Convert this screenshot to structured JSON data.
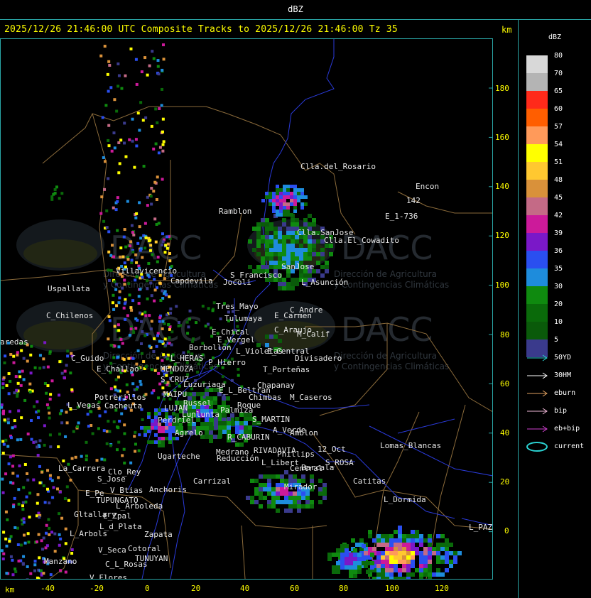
{
  "header": {
    "title": "dBZ"
  },
  "subtitle": "2025/12/26 21:46:00 UTC Composite Tracks to 2025/12/26 21:46:00 Tz 35",
  "axes": {
    "unit_label": "km",
    "y_ticks": [
      "180",
      "160",
      "140",
      "120",
      "100",
      "80",
      "60",
      "40",
      "20",
      "0"
    ],
    "x_ticks": [
      "-40",
      "-20",
      "0",
      "20",
      "40",
      "60",
      "80",
      "100",
      "120"
    ]
  },
  "legend": {
    "title": "dBZ",
    "bins": [
      {
        "label": "80",
        "color": "#d8d8d8"
      },
      {
        "label": "70",
        "color": "#b4b4b4"
      },
      {
        "label": "65",
        "color": "#ff2a1a"
      },
      {
        "label": "60",
        "color": "#ff5e00"
      },
      {
        "label": "57",
        "color": "#ff9a5a"
      },
      {
        "label": "54",
        "color": "#ffff00"
      },
      {
        "label": "51",
        "color": "#ffc830"
      },
      {
        "label": "48",
        "color": "#d9913a"
      },
      {
        "label": "45",
        "color": "#c46a86"
      },
      {
        "label": "42",
        "color": "#cc1a9a"
      },
      {
        "label": "39",
        "color": "#7a18c8"
      },
      {
        "label": "36",
        "color": "#2a4ff0"
      },
      {
        "label": "35",
        "color": "#1e8cdc"
      },
      {
        "label": "30",
        "color": "#0f8a0f"
      },
      {
        "label": "20",
        "color": "#0a6a0a"
      },
      {
        "label": "10",
        "color": "#0a5a0a"
      },
      {
        "label": "5",
        "color": "#3a3a8c"
      }
    ],
    "tracks": [
      {
        "label": "50YD",
        "color": "#2ad0d0"
      },
      {
        "label": "30HM",
        "color": "#ffffff"
      },
      {
        "label": "eburn",
        "color": "#e0a060"
      },
      {
        "label": "bip",
        "color": "#f0b8d8"
      },
      {
        "label": "eb+bip",
        "color": "#d040d0"
      },
      {
        "label": "current",
        "color": "#2ad0d0"
      }
    ]
  },
  "places": [
    {
      "name": "Clla.del_Rosario"
    },
    {
      "name": "Encon"
    },
    {
      "name": "142"
    },
    {
      "name": "E_1-736"
    },
    {
      "name": "Ramblon"
    },
    {
      "name": "Clla.SanJose"
    },
    {
      "name": "Clla.El_Cowadito"
    },
    {
      "name": "Villavicencio"
    },
    {
      "name": "Capdevila"
    },
    {
      "name": "S_Francisco"
    },
    {
      "name": "Jocoli"
    },
    {
      "name": "SanJose"
    },
    {
      "name": "L_Asunción"
    },
    {
      "name": "Uspallata"
    },
    {
      "name": "Tres_Mayo"
    },
    {
      "name": "C_Andre"
    },
    {
      "name": "C_Chilenos"
    },
    {
      "name": "Tulumaya"
    },
    {
      "name": "E_Carmen"
    },
    {
      "name": "E_Chical"
    },
    {
      "name": "C_Araujo"
    },
    {
      "name": "M_Calif"
    },
    {
      "name": "E_Vergel"
    },
    {
      "name": "Borbollon"
    },
    {
      "name": "L_Violetas"
    },
    {
      "name": "E_Central"
    },
    {
      "name": "Divisadero"
    },
    {
      "name": "aredas"
    },
    {
      "name": "C_Guido"
    },
    {
      "name": "L_HERAS"
    },
    {
      "name": "P_Hierro"
    },
    {
      "name": "E_Challao"
    },
    {
      "name": "MENDOZA"
    },
    {
      "name": "T_Porteñas"
    },
    {
      "name": "S_CRUZ"
    },
    {
      "name": "Luzuriaga"
    },
    {
      "name": "Chapanay"
    },
    {
      "name": "E_L_Beltran"
    },
    {
      "name": "Potrerillos"
    },
    {
      "name": "MAIPU"
    },
    {
      "name": "Chimbas"
    },
    {
      "name": "M_Caseros"
    },
    {
      "name": "L_Vegas"
    },
    {
      "name": "Cacheuta"
    },
    {
      "name": "Russel"
    },
    {
      "name": "Roque"
    },
    {
      "name": "LUJAN"
    },
    {
      "name": "Lunlunta"
    },
    {
      "name": "Palmiza"
    },
    {
      "name": "S_MARTIN"
    },
    {
      "name": "Perdriel"
    },
    {
      "name": "A_Verde"
    },
    {
      "name": "Amblon"
    },
    {
      "name": "Agrelo"
    },
    {
      "name": "R_CABURIN"
    },
    {
      "name": "Lomas_Blancas"
    },
    {
      "name": "Medrano"
    },
    {
      "name": "RIVADAVIA"
    },
    {
      "name": "12_Oct"
    },
    {
      "name": "Ugarteche"
    },
    {
      "name": "Reducción"
    },
    {
      "name": "Phillips"
    },
    {
      "name": "L_Libert"
    },
    {
      "name": "S_ROSA"
    },
    {
      "name": "La_Carrera"
    },
    {
      "name": "Clo_Rey"
    },
    {
      "name": "Carrizal"
    },
    {
      "name": "Barcala"
    },
    {
      "name": "Catitas"
    },
    {
      "name": "S_Jose"
    },
    {
      "name": "Anchoris"
    },
    {
      "name": "E_Pe"
    },
    {
      "name": "V_Btias"
    },
    {
      "name": "Mirador"
    },
    {
      "name": "Central"
    },
    {
      "name": "TUPUNGATO"
    },
    {
      "name": "L_Arboleda"
    },
    {
      "name": "L_Dormida"
    },
    {
      "name": "Gltallary"
    },
    {
      "name": "E_Zpal"
    },
    {
      "name": "L_d_Plata"
    },
    {
      "name": "L_PAZ"
    },
    {
      "name": "L_Arbols"
    },
    {
      "name": "Zapata"
    },
    {
      "name": "V_Seca"
    },
    {
      "name": "Cotoral"
    },
    {
      "name": "Manzano"
    },
    {
      "name": "TUNUYAN"
    },
    {
      "name": "C_L_Rosas"
    },
    {
      "name": "V_Flores"
    }
  ],
  "watermark": {
    "line1": "DACC",
    "line2": "Dirección de Agricultura",
    "line3": "y Contingencias Climáticas"
  }
}
